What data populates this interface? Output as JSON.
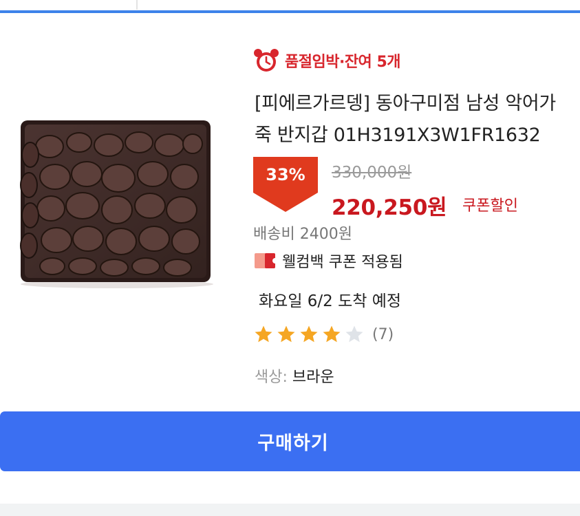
{
  "urgency_badge": "품절임박·잔여 5개",
  "product": {
    "title_lines": [
      "[피에르가르뎅] 동아구미점 남성 악어가",
      "죽 반지갑 01H3191X3W1FR1632"
    ],
    "discount": "33%",
    "original_price": "330,000원",
    "sale_price": "220,250원",
    "coupon_label": "쿠폰할인",
    "shipping": "배송비 2400원",
    "welcome_coupon": "웰컴백 쿠폰 적용됨",
    "delivery": "화요일 6/2 도착 예정",
    "rating_stars": 4,
    "rating_max": 5,
    "review_count": "(7)",
    "color_label": "색상:",
    "color_value": "브라운"
  },
  "buy_button_label": "구매하기",
  "colors": {
    "accent_red": "#d8262d",
    "button_blue": "#3b6ff2",
    "star_gold": "#f5a623",
    "star_empty": "#dfe3e8"
  }
}
